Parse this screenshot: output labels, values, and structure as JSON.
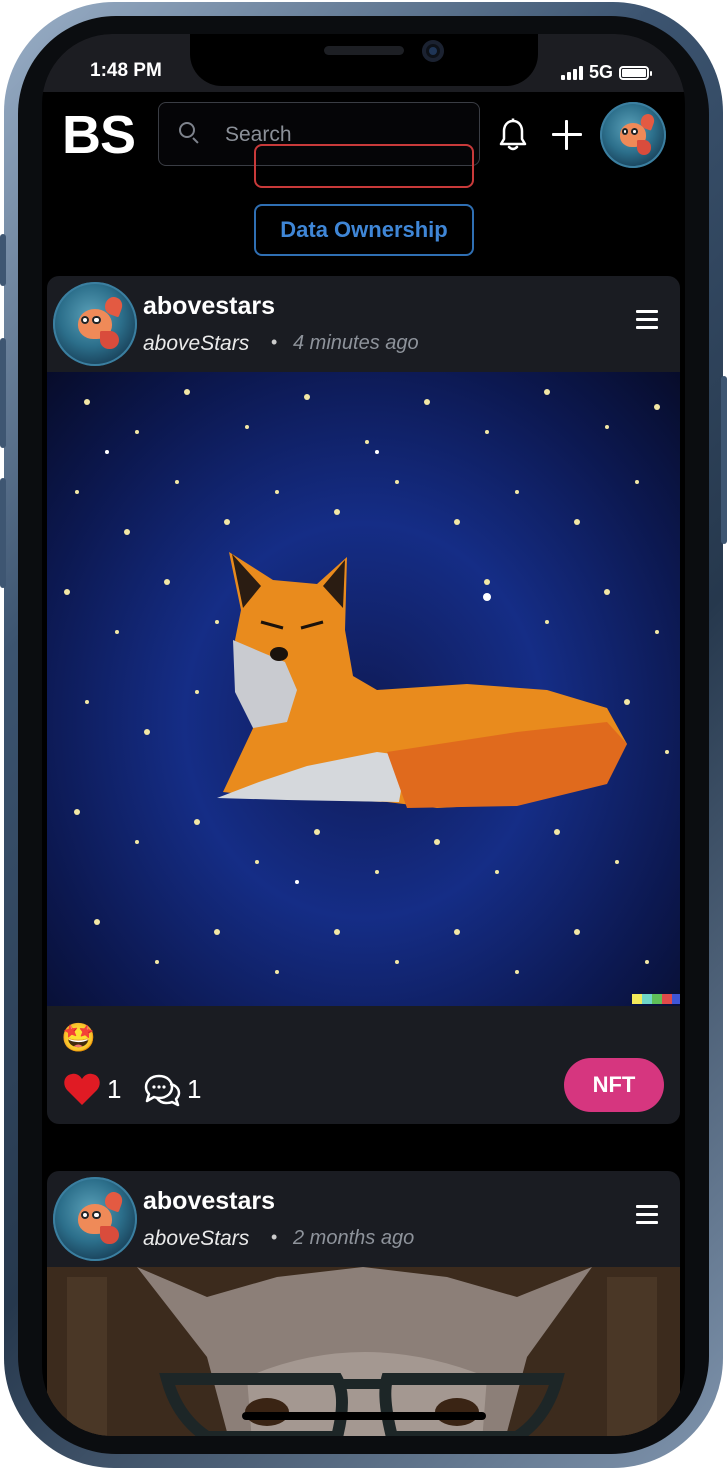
{
  "status_bar": {
    "time": "1:48 PM",
    "network": "5G"
  },
  "header": {
    "logo": "BS",
    "search_placeholder": "Search",
    "icons": [
      "bell-icon",
      "plus-icon",
      "user-avatar"
    ]
  },
  "buttons": {
    "data_ownership": "Data Ownership"
  },
  "posts": [
    {
      "username": "abovestars",
      "handle": "aboveStars",
      "separator": "•",
      "time_ago": "4 minutes ago",
      "image": "fox-in-starry-night-painting",
      "reaction": "🤩",
      "likes": "1",
      "comments": "1",
      "nft_label": "NFT"
    },
    {
      "username": "abovestars",
      "handle": "aboveStars",
      "separator": "•",
      "time_ago": "2 months ago",
      "image": "wolf-with-glasses-photo"
    }
  ],
  "colors": {
    "background": "#000000",
    "card": "#1a1c22",
    "accent_blue": "#3f86d6",
    "nft_pink": "#d6367f",
    "heart_red": "#e01b24"
  }
}
